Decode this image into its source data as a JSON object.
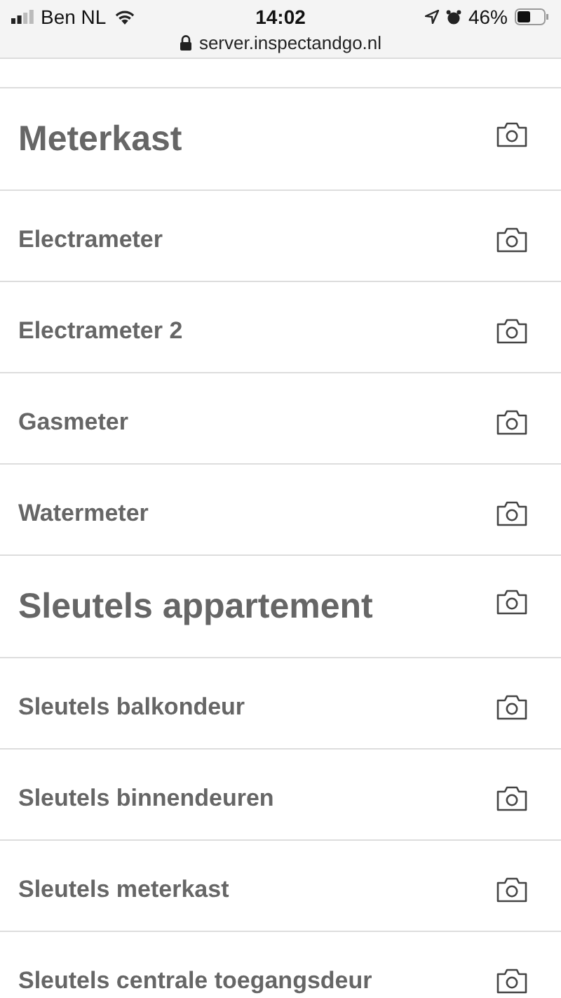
{
  "status_bar": {
    "carrier": "Ben NL",
    "time": "14:02",
    "battery": "46%",
    "url": "server.inspectandgo.nl"
  },
  "rows": [
    {
      "kind": "section",
      "label": "Meterkast"
    },
    {
      "kind": "item",
      "label": "Electrameter"
    },
    {
      "kind": "item",
      "label": "Electrameter 2"
    },
    {
      "kind": "item",
      "label": "Gasmeter"
    },
    {
      "kind": "item",
      "label": "Watermeter"
    },
    {
      "kind": "section",
      "label": "Sleutels appartement"
    },
    {
      "kind": "item",
      "label": "Sleutels balkondeur"
    },
    {
      "kind": "item",
      "label": "Sleutels binnendeuren"
    },
    {
      "kind": "item",
      "label": "Sleutels meterkast"
    },
    {
      "kind": "item",
      "label": "Sleutels centrale toegangsdeur"
    }
  ]
}
